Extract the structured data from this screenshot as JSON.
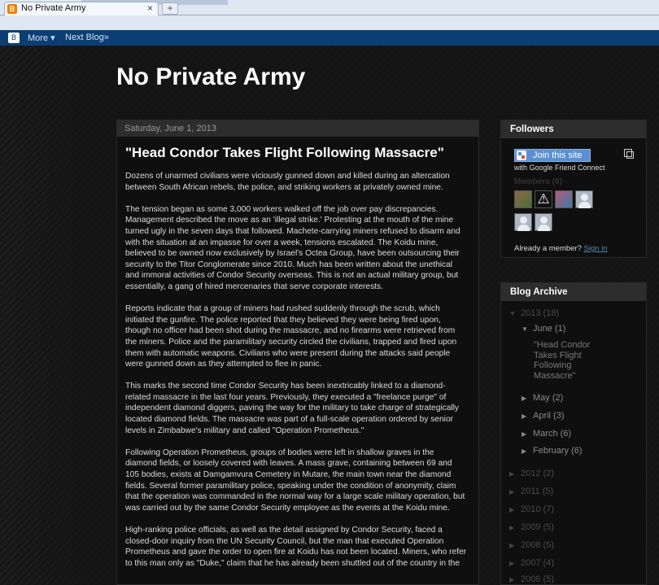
{
  "browser": {
    "tab_title": "No Private Army",
    "tab_close": "×",
    "new_tab": "+"
  },
  "navbar": {
    "more": "More ▾",
    "next_blog": "Next Blog»"
  },
  "blog": {
    "title": "No Private Army"
  },
  "post": {
    "date": "Saturday, June 1, 2013",
    "title": "\"Head Condor Takes Flight Following Massacre\"",
    "paragraphs": [
      "Dozens of unarmed civilians were viciously gunned down and killed during an altercation between South African rebels, the police, and striking workers at privately owned mine.",
      "The tension began as some 3,000 workers walked off the job over pay discrepancies. Management described the move as an 'illegal strike.' Protesting at the mouth of the mine turned ugly in the seven days that followed. Machete-carrying miners refused to disarm and with the situation at an impasse for over a week, tensions escalated. The Koidu mine, believed to be owned now exclusively by Israel's Octea Group, have been outsourcing their security to the Titor Conglomerate since 2010. Much has been written about the unethical and immoral activities of Condor Security overseas. This is not an actual military group, but essentially, a gang of hired mercenaries that serve corporate interests.",
      "Reports indicate that a group of miners had rushed suddenly through the scrub, which initiated the gunfire. The police reported that they believed they were being fired upon, though no officer had been shot during the massacre, and no firearms were retrieved from the miners. Police and the paramilitary security circled the civilians, trapped and fired upon them with automatic weapons. Civilians who were present during the attacks said people were gunned down as they attempted to flee in panic.",
      "This marks the second time Condor Security has been inextricably linked to a diamond-related massacre in the last four years. Previously, they executed a \"freelance purge\" of independent diamond diggers, paving the way for the military to take charge of strategically located diamond fields. The massacre was part of a full-scale operation ordered by senior levels in Zimbabwe's military and called \"Operation Prometheus.\"",
      "Following Operation Prometheus, groups of bodies were left in shallow graves in the diamond fields, or loosely covered with leaves. A mass grave, containing between 69 and 105 bodies, exists at Damgamvura Cemetery in Mutare, the main town near the diamond fields. Several former paramilitary police, speaking under the condition of anonymity, claim that the operation was commanded in the normal way for a large scale military operation, but was carried out by the same Condor Security employee as the events at the Koidu mine.",
      "High-ranking police officials, as well as the detail assigned by Condor Security, faced a closed-door inquiry from the UN Security Council, but the man that executed Operation Prometheus and gave the order to open fire at Koidu has not been located. Miners, who refer to this man only as \"Duke,\" claim that he has already been shuttled out of the country in the"
    ]
  },
  "followers": {
    "heading": "Followers",
    "join_label": "Join this site",
    "gfc_text": "with Google Friend Connect",
    "members_label": "Members (6)",
    "already_text": "Already a member?",
    "sign_in": "Sign in"
  },
  "archive": {
    "heading": "Blog Archive",
    "years": [
      {
        "label": "2013",
        "count": "(18)",
        "expanded": true
      },
      {
        "label": "2012",
        "count": "(2)"
      },
      {
        "label": "2011",
        "count": "(5)"
      },
      {
        "label": "2010",
        "count": "(7)"
      },
      {
        "label": "2009",
        "count": "(5)"
      },
      {
        "label": "2008",
        "count": "(5)"
      },
      {
        "label": "2007",
        "count": "(4)"
      },
      {
        "label": "2006",
        "count": "(5)"
      }
    ],
    "months": [
      {
        "label": "June",
        "count": "(1)",
        "expanded": true
      },
      {
        "label": "May",
        "count": "(2)"
      },
      {
        "label": "April",
        "count": "(3)"
      },
      {
        "label": "March",
        "count": "(6)"
      },
      {
        "label": "February",
        "count": "(6)"
      }
    ],
    "post_lines": [
      "\"Head Condor",
      "Takes Flight",
      "Following",
      "Massacre\""
    ]
  },
  "icons": {
    "expanded_arrow": "▼",
    "collapsed_arrow": "▶"
  }
}
